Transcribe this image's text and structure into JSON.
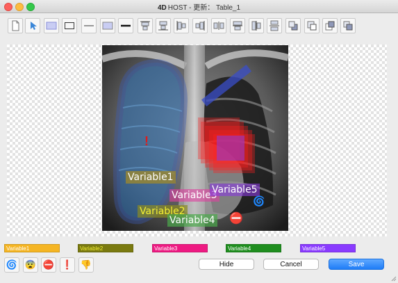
{
  "window": {
    "logo": "4D",
    "title": "HOST - 更新： Table_1"
  },
  "toolbar": {
    "tools": [
      {
        "name": "new-page-icon"
      },
      {
        "name": "pointer-tool-icon"
      },
      {
        "name": "filled-rectangle-tool-icon"
      },
      {
        "name": "rectangle-outline-tool-icon"
      },
      {
        "name": "thin-line-tool-icon"
      },
      {
        "name": "rectangle-fill-style-icon"
      },
      {
        "name": "thick-line-tool-icon"
      },
      {
        "name": "align-top-icon"
      },
      {
        "name": "align-bottom-icon"
      },
      {
        "name": "align-left-icon"
      },
      {
        "name": "align-right-icon"
      },
      {
        "name": "distribute-horizontal-icon"
      },
      {
        "name": "align-center-vertical-icon"
      },
      {
        "name": "align-center-horizontal-icon"
      },
      {
        "name": "distribute-vertical-icon"
      },
      {
        "name": "send-to-back-icon"
      },
      {
        "name": "move-backward-icon"
      },
      {
        "name": "bring-forward-icon"
      },
      {
        "name": "bring-to-front-icon"
      }
    ]
  },
  "image": {
    "labels": [
      {
        "text": "Variable1",
        "color": "#a08a2a"
      },
      {
        "text": "Variable2",
        "color": "#8a8a22"
      },
      {
        "text": "Variable3",
        "color": "#e040a0"
      },
      {
        "text": "Variable4",
        "color": "#4caa4c"
      },
      {
        "text": "Variable5",
        "color": "#8a3adf"
      }
    ],
    "markers": {
      "exclamation": "!",
      "no_entry": "⛔",
      "cyclone": "🌀"
    }
  },
  "variables": [
    {
      "label": "Variable1",
      "color": "#f5b523"
    },
    {
      "label": "Variable2",
      "color": "#7a7a10"
    },
    {
      "label": "Variable3",
      "color": "#ee1a82"
    },
    {
      "label": "Variable4",
      "color": "#1f8e1f"
    },
    {
      "label": "Variable5",
      "color": "#8a3bff"
    }
  ],
  "icons": [
    {
      "name": "cyclone-icon",
      "glyph": "🌀"
    },
    {
      "name": "fearful-face-icon",
      "glyph": "😨"
    },
    {
      "name": "no-entry-icon",
      "glyph": "⛔"
    },
    {
      "name": "exclamation-icon",
      "glyph": "❗"
    },
    {
      "name": "thumbs-down-icon",
      "glyph": "👎"
    }
  ],
  "actions": {
    "hide": "Hide",
    "cancel": "Cancel",
    "save": "Save"
  }
}
